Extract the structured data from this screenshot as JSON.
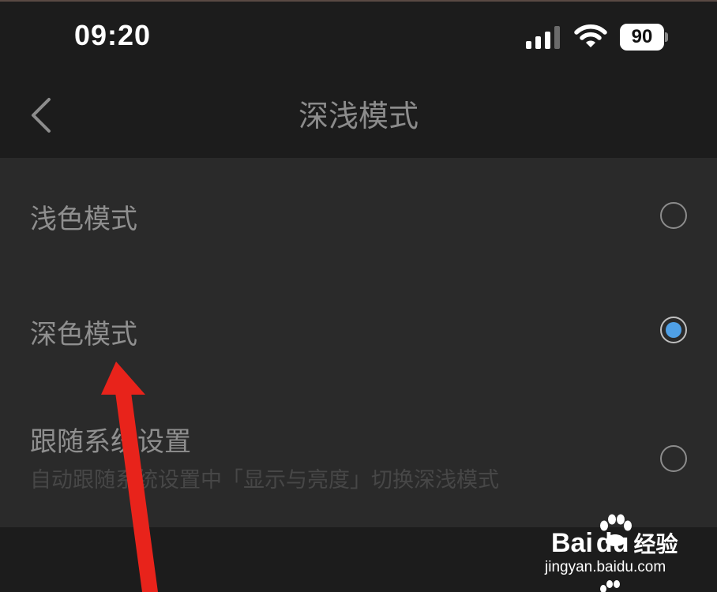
{
  "status_bar": {
    "time": "09:20",
    "battery": "90",
    "icons": [
      "cellular-signal-icon",
      "wifi-icon",
      "battery-icon"
    ]
  },
  "nav": {
    "back_icon": "chevron-left-icon",
    "title": "深浅模式"
  },
  "options": [
    {
      "label": "浅色模式",
      "selected": false
    },
    {
      "label": "深色模式",
      "selected": true
    },
    {
      "label": "跟随系统设置",
      "sublabel": "自动跟随系统设置中「显示与亮度」切换深浅模式",
      "selected": false
    }
  ],
  "watermark": {
    "logo_text_bai": "Bai",
    "logo_text_du": "du",
    "logo_text_cn": "经验",
    "url": "jingyan.baidu.com"
  },
  "colors": {
    "background": "#1f1f1f",
    "panel": "#2a2a2a",
    "accent_radio": "#4fa0e6",
    "annotation_arrow": "#e8231b"
  }
}
